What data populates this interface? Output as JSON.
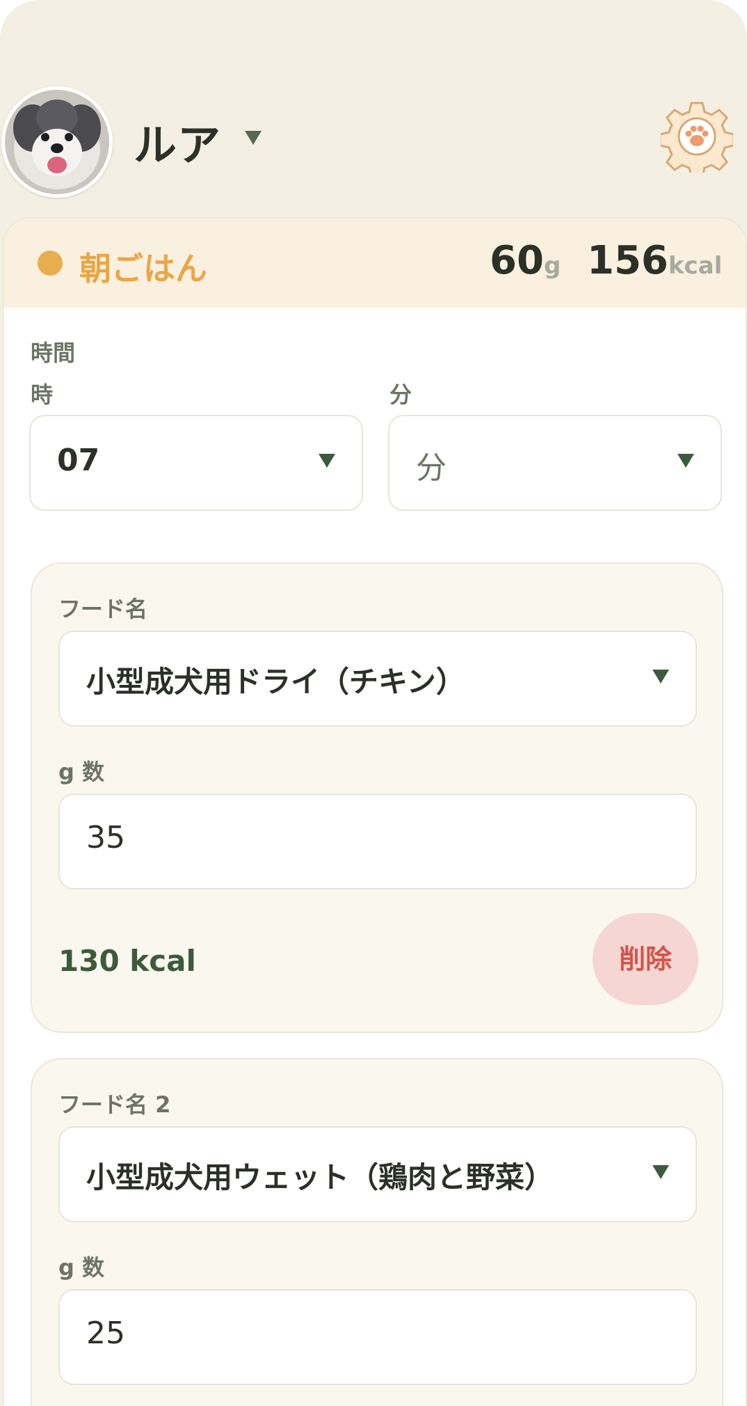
{
  "header": {
    "pet_name": "ルア",
    "avatar_alt": "dog",
    "icons": {
      "caret": "chevron-down-icon",
      "settings": "paw-gear-icon"
    }
  },
  "meal": {
    "title": "朝ごはん",
    "grams_value": "60",
    "grams_unit": "g",
    "kcal_value": "156",
    "kcal_unit": "kcal",
    "accent_color": "#e8a748"
  },
  "time": {
    "section_label": "時間",
    "hour_label": "時",
    "hour_value": "07",
    "minute_label": "分",
    "minute_placeholder": "分"
  },
  "foods": [
    {
      "name_label": "フード名",
      "name_value": "小型成犬用ドライ（チキン）",
      "grams_label": "g 数",
      "grams_value": "35",
      "kcal": "130 kcal",
      "delete_label": "削除"
    },
    {
      "name_label": "フード名 2",
      "name_value": "小型成犬用ウェット（鶏肉と野菜）",
      "grams_label": "g 数",
      "grams_value": "25"
    }
  ],
  "colors": {
    "primary_dark": "#3c5a3c",
    "danger": "#d3544a",
    "danger_bg": "#f5d6d2",
    "background": "#f3efe3"
  }
}
